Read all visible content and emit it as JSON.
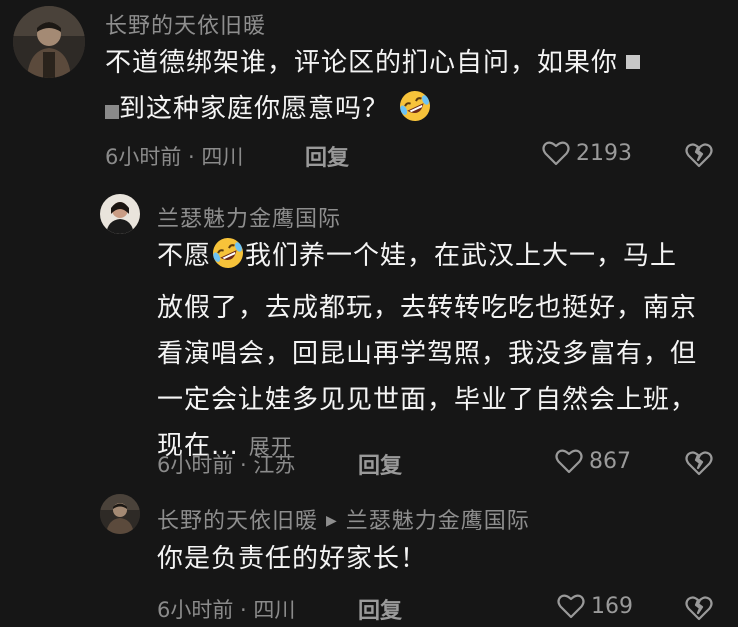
{
  "comments": [
    {
      "user": "长野的天依旧暖",
      "text_a": "不道德绑架谁，评论区的扪心自问，如果你",
      "text_b": "到这种家庭你愿意吗？",
      "time": "6小时前 · 四川",
      "reply_label": "回复",
      "likes": "2193"
    },
    {
      "user": "兰瑟魅力金鹰国际",
      "text_a": "不愿",
      "text_b": "我们养一个娃，在武汉上大一，马上放假了，去成都玩，去转转吃吃也挺好，南京看演唱会，回昆山再学驾照，我没多富有，但一定会让娃多见见世面，毕业了自然会上班，现在...",
      "expand_label": "展开",
      "time": "6小时前 · 江苏",
      "reply_label": "回复",
      "likes": "867"
    },
    {
      "user": "长野的天依旧暖",
      "reply_to": "兰瑟魅力金鹰国际",
      "text": "你是负责任的好家长！",
      "time": "6小时前 · 四川",
      "reply_label": "回复",
      "likes": "169"
    }
  ],
  "icons": {
    "emoji": "rolling-on-floor-laughing-icon",
    "like": "heart-icon",
    "dislike": "broken-heart-icon",
    "arrow": "triangle-right-icon"
  },
  "colors": {
    "background": "#161616",
    "text": "#f4f4f4",
    "muted": "#8e8e8e"
  }
}
